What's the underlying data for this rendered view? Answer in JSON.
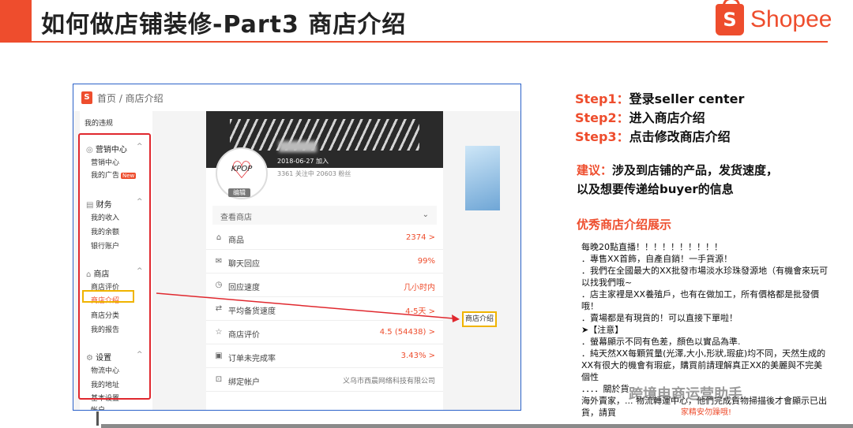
{
  "slide": {
    "title": "如何做店铺装修-Part3 商店介绍",
    "logo_text": "Shopee",
    "logo_glyph": "S",
    "accent": "#ee4d2d"
  },
  "screenshot": {
    "breadcrumb": "首页 / 商店介绍",
    "sidebar": {
      "top_item": "我的违规",
      "groups": [
        {
          "head": "营销中心",
          "items": [
            "营销中心",
            "我的广告"
          ],
          "badge": "New"
        },
        {
          "head": "财务",
          "items": [
            "我的收入",
            "我的余额",
            "银行账户"
          ]
        },
        {
          "head": "商店",
          "items": [
            "商店评价",
            "商店介绍",
            "商店分类",
            "我的报告"
          ]
        },
        {
          "head": "设置",
          "items": [
            "物流中心",
            "我的地址",
            "基本设置",
            "帐户"
          ]
        }
      ]
    },
    "profile": {
      "avatar_text": "KPOP",
      "edit_label": "编辑",
      "join_date": "2018-06-27 加入",
      "stats": "3361 关注中   20603 粉丝",
      "view_shop": "查看商店"
    },
    "rows": [
      {
        "icon": "shop-icon",
        "glyph": "⌂",
        "label": "商品",
        "value": "2374 >"
      },
      {
        "icon": "chat-icon",
        "glyph": "✉",
        "label": "聊天回应",
        "value": "99%"
      },
      {
        "icon": "clock-icon",
        "glyph": "◷",
        "label": "回应速度",
        "value": "几小时内"
      },
      {
        "icon": "truck-icon",
        "glyph": "⇄",
        "label": "平均备货速度",
        "value": "4-5天 >"
      },
      {
        "icon": "star-icon",
        "glyph": "☆",
        "label": "商店评价",
        "value": "4.5 (54438) >"
      },
      {
        "icon": "order-icon",
        "glyph": "▣",
        "label": "订单未完成率",
        "value": "3.43% >"
      },
      {
        "icon": "link-icon",
        "glyph": "⊡",
        "label": "绑定帐户",
        "value": "义乌市西晨网络科技有限公司"
      }
    ],
    "intro_label": "商店介绍"
  },
  "steps": [
    {
      "key": "Step1：",
      "text": "登录seller center"
    },
    {
      "key": "Step2：",
      "text": "进入商店介绍"
    },
    {
      "key": "Step3：",
      "text": "点击修改商店介绍"
    }
  ],
  "tip": {
    "key": "建议：",
    "text": "涉及到店铺的产品，发货速度，以及想要传递给buyer的信息"
  },
  "showcase_title": "优秀商店介绍展示",
  "intro_lines": [
    "每晚20點直播！！！！！！！！！！",
    "．專售XX首飾，自產自銷！一手貨源！",
    "．我們在全國最大的XX批發市場淡水珍珠發源地（有機會來玩可以找我們哦~",
    "．店主家裡是XX養殖戶，也有在做加工，所有價格都是批發價哦！",
    "．賣場都是有現貨的！可以直接下單啦！",
    "➤【注意】",
    "．螢幕顯示不同有色差，顏色以實品為準.",
    "．純天然XX每顆質量(光澤,大小,形狀,瑕疵)均不同，天然生成的XX有很大的機會有瑕疵，購買前請理解真正XX的美麗與不完美個性",
    "．．．．關於貨",
    "海外賣家，... 物流轉運中心，他們完成貨物掃描後才會顯示已出貨，請買"
  ],
  "watermark": "跨境电商运营助手",
  "watermark_small": "家精安勿躁哦!"
}
